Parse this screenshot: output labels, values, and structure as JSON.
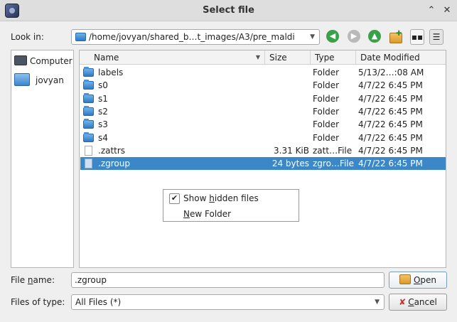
{
  "window": {
    "title": "Select file",
    "minimize_glyph": "⌃",
    "close_glyph": "✕"
  },
  "lookin": {
    "label": "Look in:",
    "path": "/home/jovyan/shared_b…t_images/A3/pre_maldi"
  },
  "nav_icons": [
    "back-icon",
    "forward-icon",
    "parent-folder-icon",
    "new-folder-icon",
    "list-view-icon",
    "detail-view-icon"
  ],
  "sidebar": {
    "items": [
      {
        "label": "Computer",
        "icon": "computer-icon"
      },
      {
        "label": "jovyan",
        "icon": "folder-icon"
      }
    ]
  },
  "columns": {
    "name": "Name",
    "size": "Size",
    "type": "Type",
    "date": "Date Modified"
  },
  "files": [
    {
      "name": "labels",
      "size": "",
      "type": "Folder",
      "date": "5/13/2…:08 AM",
      "icon": "folder-icon"
    },
    {
      "name": "s0",
      "size": "",
      "type": "Folder",
      "date": "4/7/22 6:45 PM",
      "icon": "folder-icon"
    },
    {
      "name": "s1",
      "size": "",
      "type": "Folder",
      "date": "4/7/22 6:45 PM",
      "icon": "folder-icon"
    },
    {
      "name": "s2",
      "size": "",
      "type": "Folder",
      "date": "4/7/22 6:45 PM",
      "icon": "folder-icon"
    },
    {
      "name": "s3",
      "size": "",
      "type": "Folder",
      "date": "4/7/22 6:45 PM",
      "icon": "folder-icon"
    },
    {
      "name": "s4",
      "size": "",
      "type": "Folder",
      "date": "4/7/22 6:45 PM",
      "icon": "folder-icon"
    },
    {
      "name": ".zattrs",
      "size": "3.31 KiB",
      "type": "zatt…File",
      "date": "4/7/22 6:45 PM",
      "icon": "file-icon"
    },
    {
      "name": ".zgroup",
      "size": "24 bytes",
      "type": "zgro…File",
      "date": "4/7/22 6:45 PM",
      "icon": "file-icon",
      "selected": true
    }
  ],
  "context_menu": {
    "show_hidden_pre": "Show ",
    "show_hidden_mnemonic": "h",
    "show_hidden_post": "idden files",
    "show_hidden_checked": "✔",
    "new_folder_mnemonic": "N",
    "new_folder_post": "ew Folder"
  },
  "filename": {
    "label_pre": "File ",
    "label_mnemonic": "n",
    "label_post": "ame:",
    "value": ".zgroup"
  },
  "filetype": {
    "label": "Files of type:",
    "value": "All Files (*)"
  },
  "buttons": {
    "open_mnemonic": "O",
    "open_post": "pen",
    "cancel_mnemonic": "C",
    "cancel_post": "ancel"
  },
  "colors": {
    "selection": "#3b87c8",
    "folder": "#2f7ac4",
    "nav_green": "#3aa14a"
  }
}
